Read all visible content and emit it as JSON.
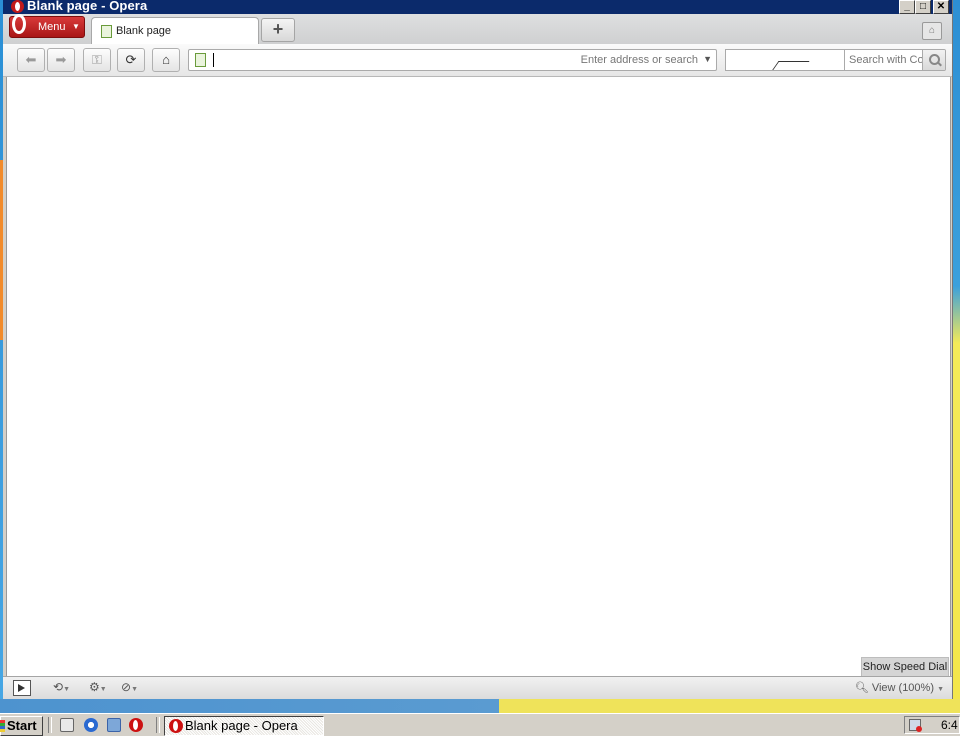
{
  "window": {
    "title": "Blank page - Opera",
    "controls": {
      "minimize": "_",
      "maximize": "□",
      "close": "✕"
    }
  },
  "menu": {
    "label": "Menu"
  },
  "tabs": [
    {
      "label": "Blank page",
      "active": true
    }
  ],
  "new_tab": {
    "label": "+"
  },
  "toolbar": {
    "back_icon": "arrow-left-icon",
    "forward_icon": "arrow-right-icon",
    "key_icon": "key-icon",
    "reload_icon": "reload-icon",
    "home_icon": "home-icon",
    "address": {
      "value": "",
      "hint": "Enter address or search"
    },
    "search": {
      "placeholder": "Search with Co"
    }
  },
  "page": {
    "speed_dial_label": "Show Speed Dial"
  },
  "statusbar": {
    "zoom_label": "View (100%)"
  },
  "taskbar": {
    "start_label": "Start",
    "task_label": "Blank page - Opera",
    "clock": "6:4"
  },
  "colors": {
    "titlebar": "#0b2a6b",
    "menu_button": "#c0201f",
    "desktop": "#3a9bd9"
  }
}
